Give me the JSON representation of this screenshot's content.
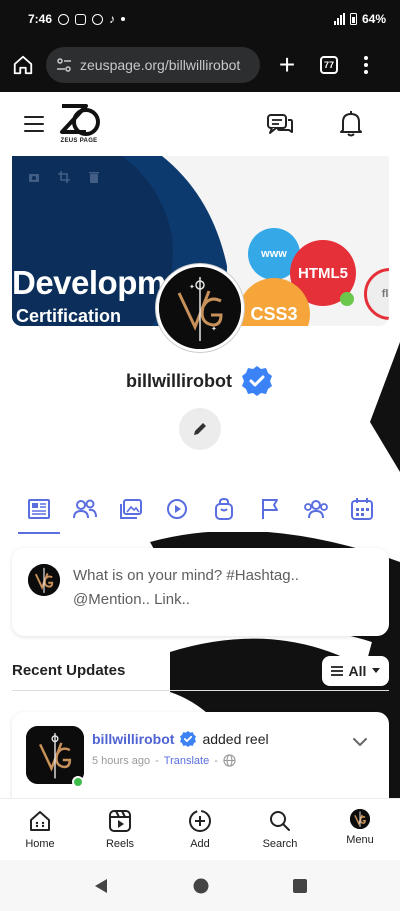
{
  "status_bar": {
    "time": "7:46",
    "battery": "64%"
  },
  "browser": {
    "url": "zeuspage.org/billwillirobot",
    "tab_count": "77"
  },
  "header": {
    "logo_text": "ZEUS PAGE"
  },
  "cover": {
    "title": "Developme",
    "subtitle": "Certification",
    "bubbles": [
      "www",
      "HTML5",
      "CSS3",
      "flat"
    ]
  },
  "profile": {
    "username": "billwillirobot",
    "verified": true,
    "avatar_monogram": "VG"
  },
  "tabs": [
    {
      "name": "timeline",
      "icon": "newspaper-icon",
      "active": true
    },
    {
      "name": "friends",
      "icon": "users-icon",
      "active": false
    },
    {
      "name": "photos",
      "icon": "images-icon",
      "active": false
    },
    {
      "name": "videos",
      "icon": "play-icon",
      "active": false
    },
    {
      "name": "products",
      "icon": "shopping-bag-icon",
      "active": false
    },
    {
      "name": "pages",
      "icon": "flag-icon",
      "active": false
    },
    {
      "name": "groups",
      "icon": "group-icon",
      "active": false
    },
    {
      "name": "events",
      "icon": "calendar-icon",
      "active": false
    }
  ],
  "composer": {
    "placeholder": "What is on your mind? #Hashtag.. @Mention.. Link.."
  },
  "feed": {
    "section_title": "Recent Updates",
    "filter_label": "All",
    "post": {
      "author": "billwillirobot",
      "action": "added reel",
      "time": "5 hours ago",
      "translate": "Translate",
      "separator": "-"
    }
  },
  "bottom_nav": [
    {
      "label": "Home",
      "icon": "home-icon"
    },
    {
      "label": "Reels",
      "icon": "reels-icon"
    },
    {
      "label": "Add",
      "icon": "add-icon"
    },
    {
      "label": "Search",
      "icon": "search-icon"
    },
    {
      "label": "Menu",
      "icon": "avatar-icon"
    }
  ],
  "colors": {
    "accent": "#5a6ee0",
    "verified": "#3b82f6",
    "online": "#3cbd4a"
  }
}
